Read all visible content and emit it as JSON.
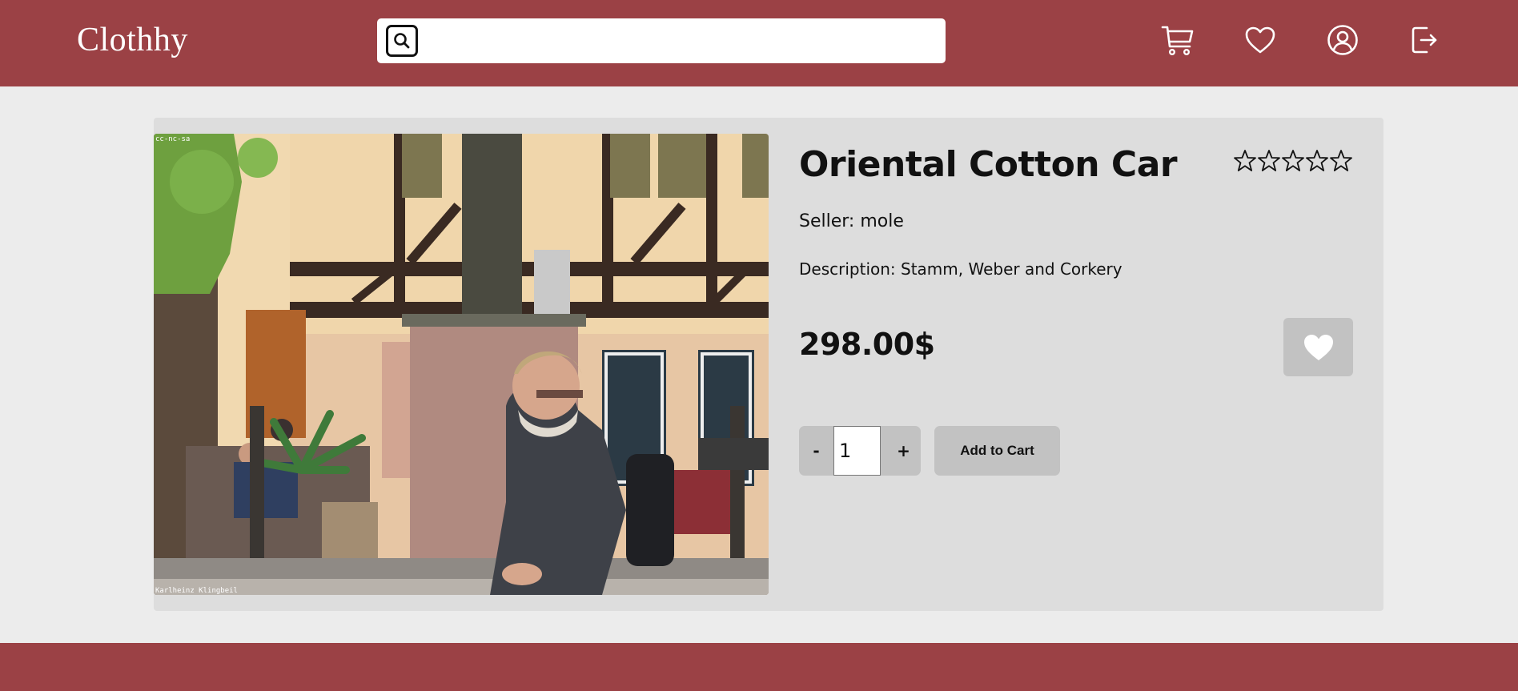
{
  "header": {
    "brand": "Clothhy",
    "search": {
      "placeholder": "",
      "value": ""
    },
    "icons": [
      "cart-icon",
      "heart-icon",
      "user-icon",
      "logout-icon"
    ]
  },
  "product": {
    "title": "Oriental Cotton Car",
    "rating": 0,
    "rating_max": 5,
    "seller": "Seller: mole",
    "description": "Description: Stamm, Weber and Corkery",
    "price": "298.00$",
    "quantity": "1",
    "minus_label": "-",
    "plus_label": "+",
    "add_to_cart_label": "Add to Cart",
    "image_watermark_top": "cc-nc-sa",
    "image_watermark_bottom": "Karlheinz Klingbeil"
  },
  "colors": {
    "brand": "#9b4145",
    "page_bg": "#ececec",
    "card_bg": "#dddddd",
    "button_bg": "#c2c2c2"
  }
}
